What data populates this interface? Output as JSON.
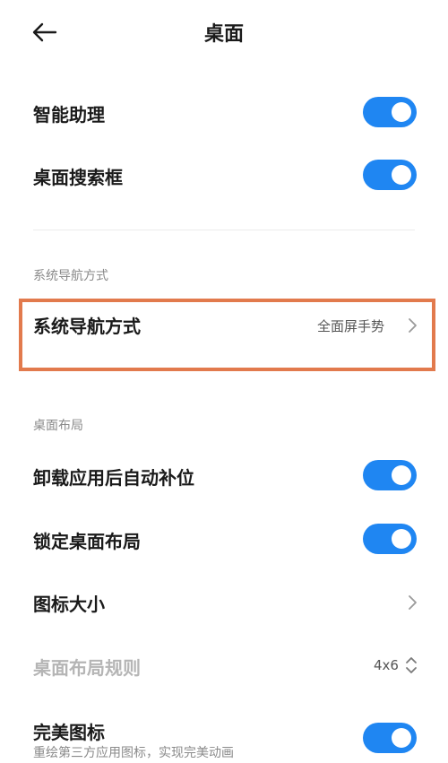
{
  "header": {
    "title": "桌面"
  },
  "settings": {
    "smart_assistant": {
      "label": "智能助理",
      "enabled": true
    },
    "search_bar": {
      "label": "桌面搜索框",
      "enabled": true
    },
    "nav_section": {
      "title": "系统导航方式"
    },
    "nav_mode": {
      "label": "系统导航方式",
      "value": "全面屏手势"
    },
    "layout_section": {
      "title": "桌面布局"
    },
    "auto_fill": {
      "label": "卸载应用后自动补位",
      "enabled": true
    },
    "lock_layout": {
      "label": "锁定桌面布局",
      "enabled": true
    },
    "icon_size": {
      "label": "图标大小"
    },
    "layout_rule": {
      "label": "桌面布局规则",
      "value": "4x6"
    },
    "perfect_icons": {
      "label": "完美图标",
      "subtitle": "重绘第三方应用图标，实现完美动画",
      "enabled": true
    }
  },
  "colors": {
    "accent": "#1f86f2",
    "highlight_border": "#e27a4d"
  }
}
